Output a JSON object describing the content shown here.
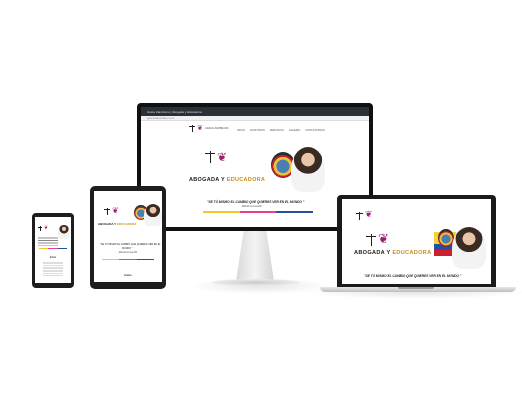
{
  "site": {
    "logo_text": "GRACE ZAMBRANO",
    "title_dark": "ABOGADA Y ",
    "title_gold": "EDUCADORA",
    "quote": "\"SE TÚ MISMO EL CAMBIO QUE QUIERES VER EN EL MUNDO \"",
    "quote_tablet_1": "\"SE TÚ MISMO EL CAMBIO QUE QUIERES VER EN EL",
    "quote_tablet_2": "MUNDO \"",
    "author": "-Mahatma Gandhi",
    "section_heading": "Inicio",
    "phone_heading": "Inicio"
  },
  "browser": {
    "tab_title": "Grace Zambrano | Abogada y Educadora",
    "address": "gracezambrano.com"
  },
  "nav": [
    "INICIO",
    "NOSOTROS",
    "SERVICIOS",
    "GALERÍA",
    "CONTÁCTANOS"
  ],
  "colors": {
    "accent_gold": "#c8901a",
    "logo_purple": "#9b1b6f",
    "stripe": [
      "#f3c623",
      "#e83e8c",
      "#2a4ea0"
    ]
  }
}
